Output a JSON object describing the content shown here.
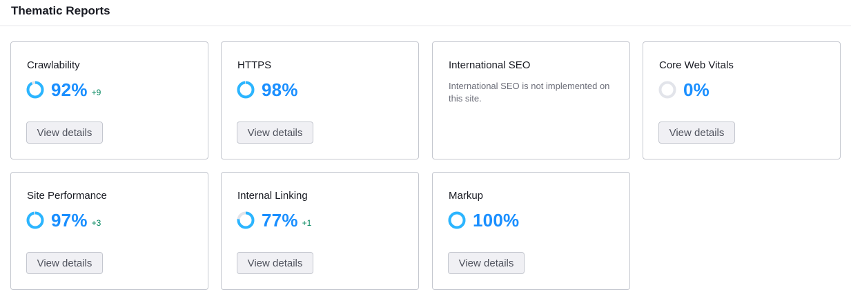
{
  "header": {
    "title": "Thematic Reports"
  },
  "cards": [
    {
      "title": "Crawlability",
      "score": "92%",
      "percent": 92,
      "delta": "+9",
      "button": "View details"
    },
    {
      "title": "HTTPS",
      "score": "98%",
      "percent": 98,
      "delta": "",
      "button": "View details"
    },
    {
      "title": "International SEO",
      "note": "International SEO is not implemented on this site."
    },
    {
      "title": "Core Web Vitals",
      "score": "0%",
      "percent": 0,
      "delta": "",
      "button": "View details"
    },
    {
      "title": "Site Performance",
      "score": "97%",
      "percent": 97,
      "delta": "+3",
      "button": "View details"
    },
    {
      "title": "Internal Linking",
      "score": "77%",
      "percent": 77,
      "delta": "+1",
      "button": "View details"
    },
    {
      "title": "Markup",
      "score": "100%",
      "percent": 100,
      "delta": "",
      "button": "View details"
    }
  ],
  "colors": {
    "ring_fill": "#2bb5ff",
    "ring_track": "#e2e4ea",
    "score": "#1a8fff",
    "delta": "#00855d"
  }
}
